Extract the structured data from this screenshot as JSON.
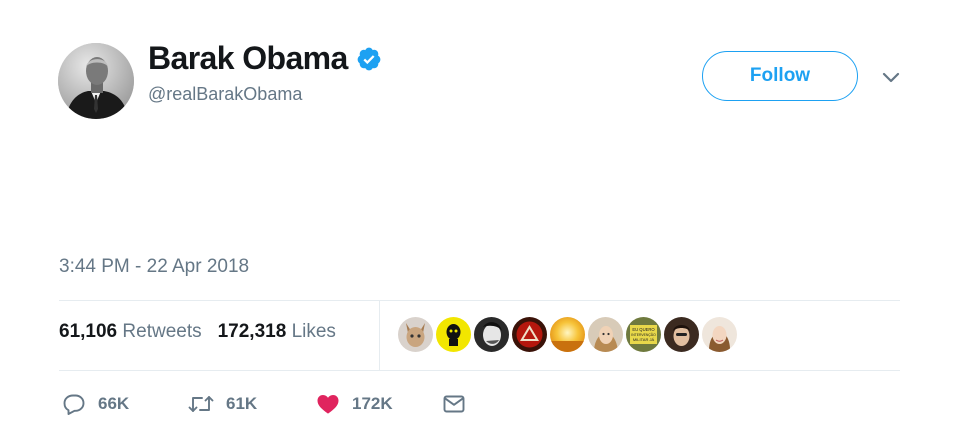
{
  "author": {
    "display_name": "Barak Obama",
    "handle": "@realBarakObama",
    "verified_icon": "verified-badge-icon"
  },
  "follow_button": {
    "label": "Follow"
  },
  "menu": {
    "icon": "chevron-down-icon"
  },
  "tweet": {
    "timestamp": "3:44 PM - 22 Apr 2018"
  },
  "stats": {
    "retweets_count": "61,106",
    "retweets_label": "Retweets",
    "likes_count": "172,318",
    "likes_label": "Likes"
  },
  "liked_by": [
    {
      "name": "liker-avatar-1"
    },
    {
      "name": "liker-avatar-2"
    },
    {
      "name": "liker-avatar-3"
    },
    {
      "name": "liker-avatar-4"
    },
    {
      "name": "liker-avatar-5"
    },
    {
      "name": "liker-avatar-6"
    },
    {
      "name": "liker-avatar-7",
      "text": "EU QUERO INTERVENÇÃO MILITAR JÁ"
    },
    {
      "name": "liker-avatar-8"
    },
    {
      "name": "liker-avatar-9"
    }
  ],
  "actions": {
    "reply": {
      "icon": "reply-icon",
      "count": "66K"
    },
    "retweet": {
      "icon": "retweet-icon",
      "count": "61K"
    },
    "like": {
      "icon": "heart-icon",
      "count": "172K"
    },
    "message": {
      "icon": "envelope-icon"
    }
  },
  "colors": {
    "accent": "#1da1f2",
    "secondary_text": "#657786",
    "primary_text": "#14171a",
    "divider": "#e6ecf0",
    "like": "#e0245e"
  }
}
